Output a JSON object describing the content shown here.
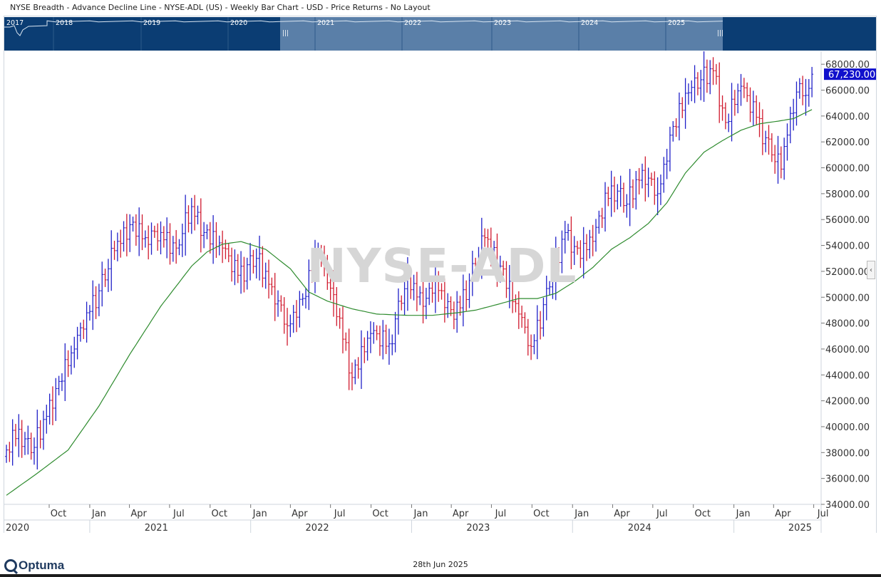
{
  "header": {
    "title": "NYSE Breadth - Advance Decline Line - NYSE-ADL (US) - Weekly Bar Chart - USD - Price Returns - No Layout"
  },
  "watermark": "NYSE-ADL",
  "footer": {
    "brand": "Optuma",
    "date": "28th Jun 2025"
  },
  "colors": {
    "up_bar": "#2020c8",
    "down_bar": "#d01a2e",
    "moving_average": "#2e8b2e",
    "price_label_bg": "#1010cc",
    "overview_bg": "#0b3d73",
    "overview_window": "#5a7fa8"
  },
  "overview": {
    "year_labels": [
      "2017",
      "2018",
      "2019",
      "2020",
      "2021",
      "2022",
      "2023",
      "2024",
      "2025"
    ]
  },
  "chart_data": {
    "type": "bar",
    "subtype": "ohlc",
    "timeframe": "weekly",
    "start_week": "2020-06-26",
    "y_axis": {
      "min": 34000,
      "max": 69000,
      "ticks": [
        34000,
        36000,
        38000,
        40000,
        42000,
        44000,
        46000,
        48000,
        50000,
        52000,
        54000,
        56000,
        58000,
        60000,
        62000,
        64000,
        66000,
        68000
      ],
      "tick_format": "0.00"
    },
    "last_price_label": "67,230.00",
    "last_price": 67230,
    "x_axis": {
      "month_ticks": [
        {
          "label": "Oct",
          "date": "2020-10-01"
        },
        {
          "label": "Jan",
          "date": "2021-01-01"
        },
        {
          "label": "Apr",
          "date": "2021-04-01"
        },
        {
          "label": "Jul",
          "date": "2021-07-01"
        },
        {
          "label": "Oct",
          "date": "2021-10-01"
        },
        {
          "label": "Jan",
          "date": "2022-01-01"
        },
        {
          "label": "Apr",
          "date": "2022-04-01"
        },
        {
          "label": "Jul",
          "date": "2022-07-01"
        },
        {
          "label": "Oct",
          "date": "2022-10-01"
        },
        {
          "label": "Jan",
          "date": "2023-01-01"
        },
        {
          "label": "Apr",
          "date": "2023-04-01"
        },
        {
          "label": "Jul",
          "date": "2023-07-01"
        },
        {
          "label": "Oct",
          "date": "2023-10-01"
        },
        {
          "label": "Jan",
          "date": "2024-01-01"
        },
        {
          "label": "Apr",
          "date": "2024-04-01"
        },
        {
          "label": "Jul",
          "date": "2024-07-01"
        },
        {
          "label": "Oct",
          "date": "2024-10-01"
        },
        {
          "label": "Jan",
          "date": "2025-01-01"
        },
        {
          "label": "Apr",
          "date": "2025-04-01"
        },
        {
          "label": "Jul",
          "date": "2025-07-01"
        }
      ],
      "year_labels": [
        {
          "label": "2020",
          "date": "2020-06-26"
        },
        {
          "label": "2021",
          "date": "2021-06-01"
        },
        {
          "label": "2022",
          "date": "2022-06-01"
        },
        {
          "label": "2023",
          "date": "2023-06-01"
        },
        {
          "label": "2024",
          "date": "2024-06-01"
        },
        {
          "label": "2025",
          "date": "2025-06-01"
        }
      ]
    },
    "close_anchors": [
      [
        0,
        38200
      ],
      [
        4,
        39800
      ],
      [
        8,
        38000
      ],
      [
        13,
        40800
      ],
      [
        17,
        43500
      ],
      [
        22,
        46000
      ],
      [
        26,
        48800
      ],
      [
        30,
        50500
      ],
      [
        35,
        53600
      ],
      [
        40,
        55600
      ],
      [
        45,
        54600
      ],
      [
        50,
        55000
      ],
      [
        55,
        53800
      ],
      [
        60,
        57000
      ],
      [
        64,
        55000
      ],
      [
        70,
        53800
      ],
      [
        75,
        51700
      ],
      [
        81,
        53000
      ],
      [
        86,
        50800
      ],
      [
        91,
        47800
      ],
      [
        96,
        49900
      ],
      [
        101,
        53500
      ],
      [
        106,
        50200
      ],
      [
        112,
        43800
      ],
      [
        118,
        47200
      ],
      [
        124,
        46400
      ],
      [
        130,
        51700
      ],
      [
        135,
        49300
      ],
      [
        139,
        51300
      ],
      [
        145,
        48300
      ],
      [
        150,
        51300
      ],
      [
        155,
        54600
      ],
      [
        160,
        52400
      ],
      [
        166,
        48700
      ],
      [
        170,
        46200
      ],
      [
        176,
        50800
      ],
      [
        181,
        55000
      ],
      [
        186,
        53000
      ],
      [
        191,
        55400
      ],
      [
        196,
        58600
      ],
      [
        201,
        57200
      ],
      [
        206,
        59800
      ],
      [
        211,
        58000
      ],
      [
        216,
        63200
      ],
      [
        221,
        65800
      ],
      [
        225,
        66800
      ],
      [
        229,
        67500
      ],
      [
        233,
        63500
      ],
      [
        238,
        66300
      ],
      [
        243,
        63900
      ],
      [
        248,
        61000
      ],
      [
        251,
        59900
      ],
      [
        254,
        64200
      ],
      [
        257,
        66500
      ],
      [
        259,
        65600
      ],
      [
        261,
        67230
      ]
    ],
    "range_pattern": [
      900,
      1400,
      1900,
      1100,
      2600,
      1600,
      1200,
      2200,
      1000,
      1700,
      3100,
      1300,
      1500,
      2000,
      1150,
      2400,
      1800,
      950,
      1350,
      2800,
      1600,
      1250,
      2100,
      1450
    ],
    "noise_pattern": [
      300,
      -700,
      900,
      -400,
      600,
      -1100,
      200,
      800,
      -500,
      -200,
      1000,
      -800,
      400,
      -300,
      700,
      -900,
      150,
      500,
      -600,
      850,
      -350,
      250,
      -750,
      450
    ],
    "moving_average": {
      "type": "40-week",
      "anchors": [
        [
          0,
          34700
        ],
        [
          10,
          36400
        ],
        [
          20,
          38200
        ],
        [
          30,
          41600
        ],
        [
          40,
          45600
        ],
        [
          50,
          49300
        ],
        [
          60,
          52400
        ],
        [
          65,
          53500
        ],
        [
          70,
          54100
        ],
        [
          76,
          54300
        ],
        [
          84,
          53700
        ],
        [
          92,
          52200
        ],
        [
          98,
          50400
        ],
        [
          104,
          49700
        ],
        [
          112,
          49100
        ],
        [
          120,
          48700
        ],
        [
          130,
          48600
        ],
        [
          138,
          48600
        ],
        [
          146,
          48800
        ],
        [
          152,
          49000
        ],
        [
          160,
          49500
        ],
        [
          166,
          49900
        ],
        [
          172,
          49900
        ],
        [
          178,
          50300
        ],
        [
          184,
          51200
        ],
        [
          190,
          52300
        ],
        [
          196,
          53700
        ],
        [
          202,
          54600
        ],
        [
          208,
          55700
        ],
        [
          214,
          57300
        ],
        [
          220,
          59600
        ],
        [
          226,
          61200
        ],
        [
          232,
          62100
        ],
        [
          238,
          62900
        ],
        [
          244,
          63400
        ],
        [
          250,
          63600
        ],
        [
          255,
          63800
        ],
        [
          261,
          64500
        ]
      ]
    }
  }
}
